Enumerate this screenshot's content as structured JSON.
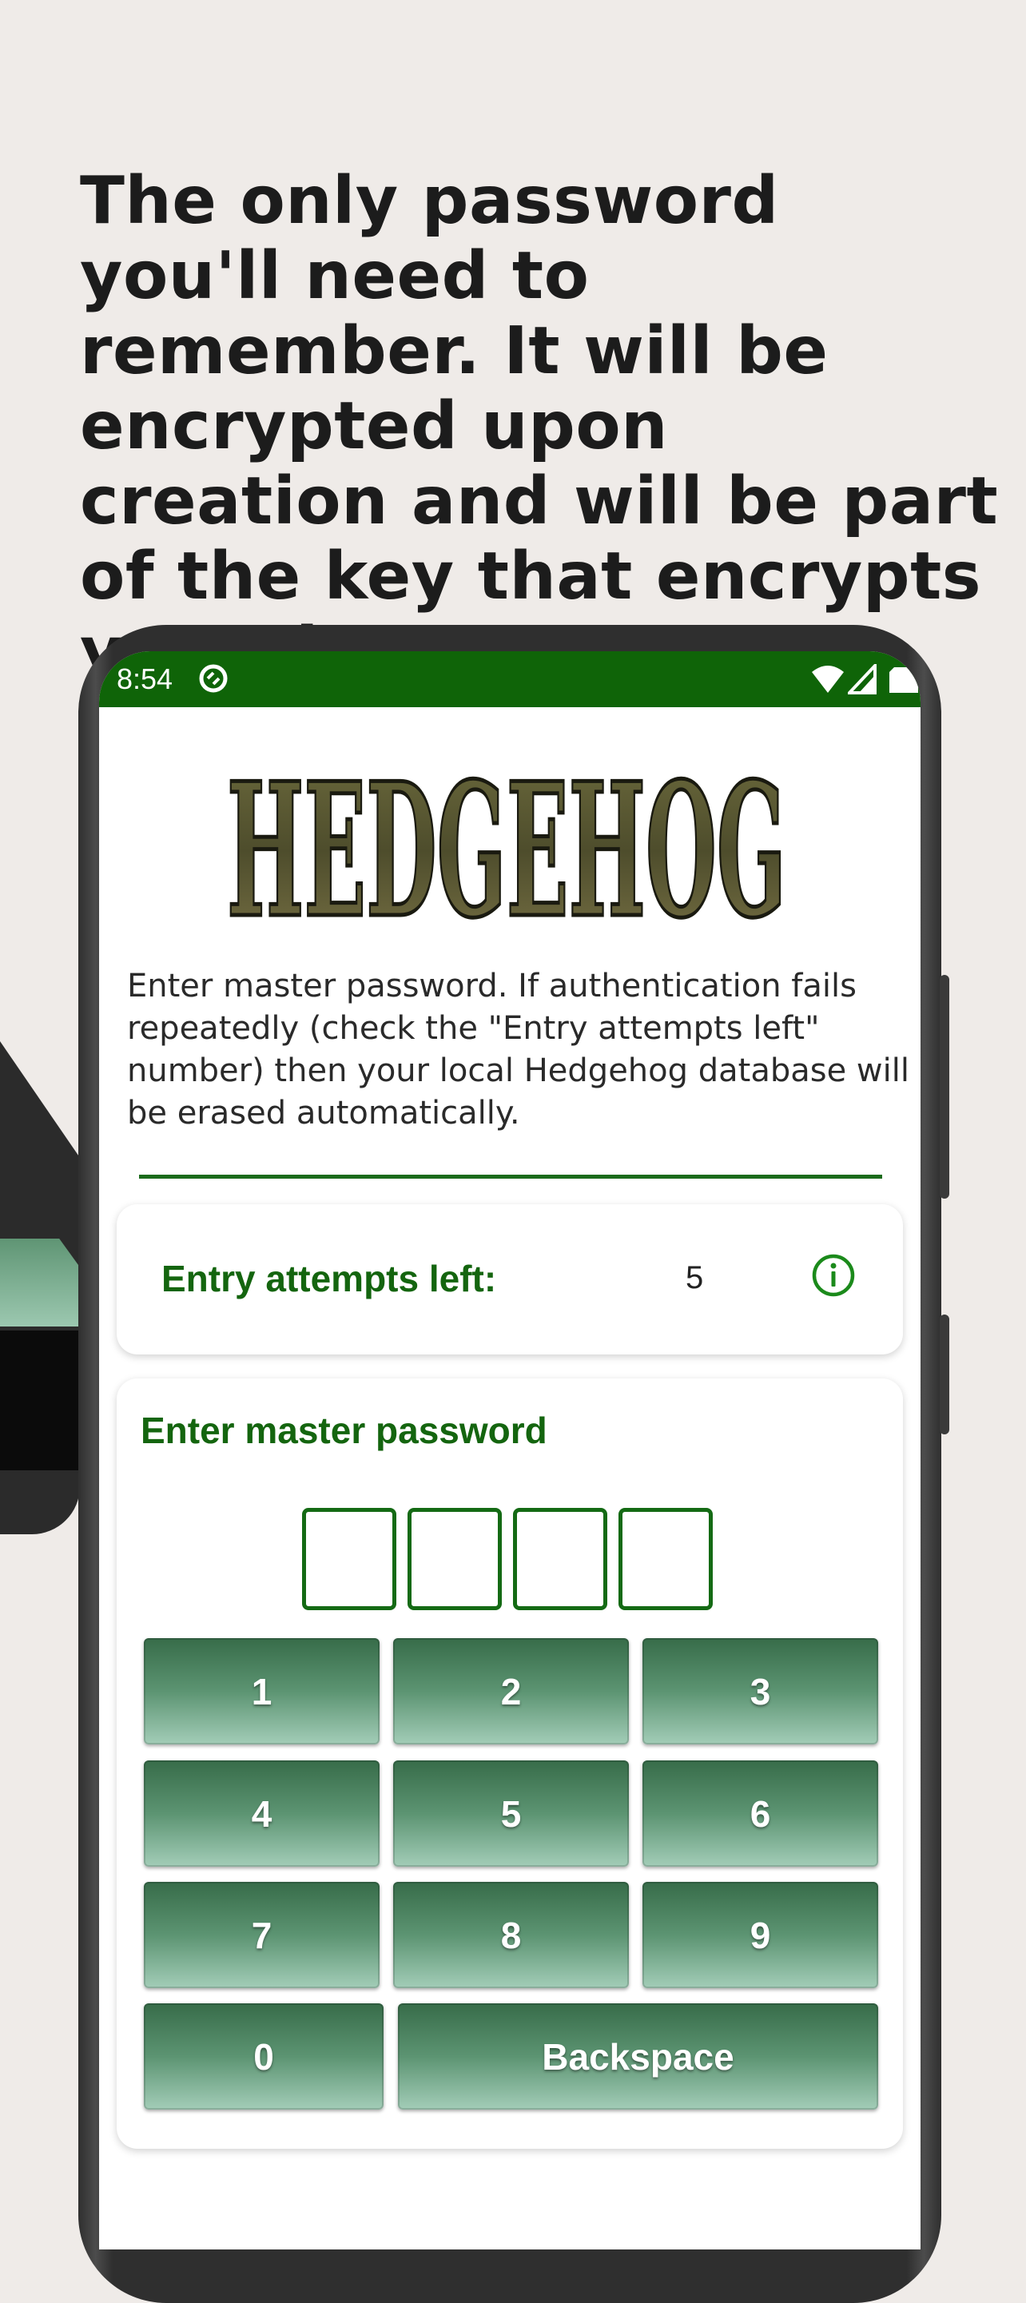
{
  "headline": "The only password you'll need to remember. It will be encrypted upon creation and will be part of the key that encrypts your data.",
  "status_bar": {
    "time": "8:54"
  },
  "app": {
    "logo_text": "HEDGEHOG",
    "description": "Enter master password. If authentication fails repeatedly (check the \"Entry attempts left\" number) then your local Hedgehog database will be erased automatically.",
    "attempts": {
      "label": "Entry attempts left:",
      "value": "5"
    },
    "password_card": {
      "title": "Enter master password",
      "digits": [
        "",
        "",
        "",
        ""
      ]
    },
    "keypad": {
      "keys": [
        "1",
        "2",
        "3",
        "4",
        "5",
        "6",
        "7",
        "8",
        "9"
      ],
      "zero": "0",
      "backspace": "Backspace"
    }
  },
  "colors": {
    "status_bar": "#0f6408",
    "accent_green": "#14650f",
    "key_top": "#376c49",
    "key_bottom": "#a3cdb8",
    "background": "#efebe8"
  }
}
